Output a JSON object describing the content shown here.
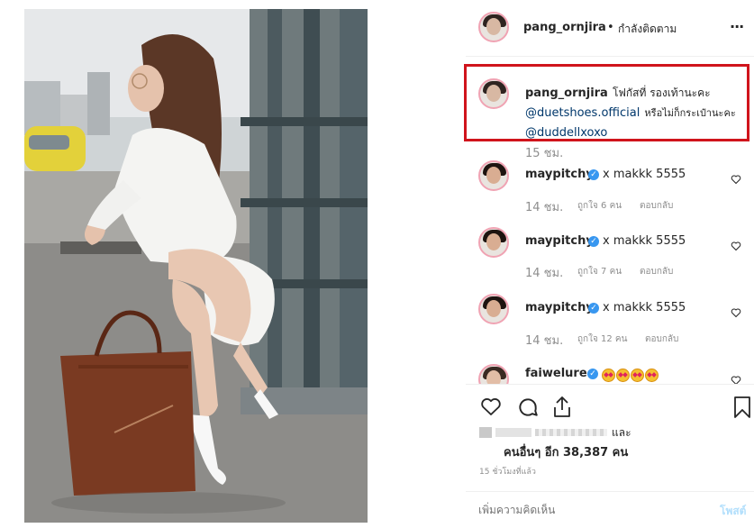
{
  "header": {
    "username": "pang_ornjira",
    "dot": "•",
    "follow_status": "กำลังติดตาม",
    "more": "···"
  },
  "caption": {
    "username": "pang_ornjira",
    "text": "โฟกัสที่ รองเท้านะคะ",
    "mention1": "@duetshoes.official",
    "text2": "หรือไม่ก็กระเป๋านะคะ",
    "mention2": "@duddellxoxo",
    "time": "15 ชม."
  },
  "comments": [
    {
      "username": "maypitchy",
      "text": "x makkk 5555",
      "time": "14 ชม.",
      "likes": "ถูกใจ 6 คน",
      "reply": "ตอบกลับ"
    },
    {
      "username": "maypitchy",
      "text": "x makkk 5555",
      "time": "14 ชม.",
      "likes": "ถูกใจ 7 คน",
      "reply": "ตอบกลับ"
    },
    {
      "username": "maypitchy",
      "text": "x makkk 5555",
      "time": "14 ชม.",
      "likes": "ถูกใจ 12 คน",
      "reply": "ตอบกลับ"
    }
  ],
  "partial_comment": {
    "username": "faiweluree"
  },
  "likes": {
    "and": "และ",
    "others": "คนอื่นๆ อีก 38,387 คน"
  },
  "timestamp": "15 ชั่วโมงที่แล้ว",
  "comment_input": {
    "placeholder": "เพิ่มความคิดเห็น",
    "post_label": "โพสต์"
  },
  "colors": {
    "link": "#00376b",
    "verified": "#3897f0",
    "highlight": "#d0141c",
    "post_disabled": "#b2dffc"
  }
}
